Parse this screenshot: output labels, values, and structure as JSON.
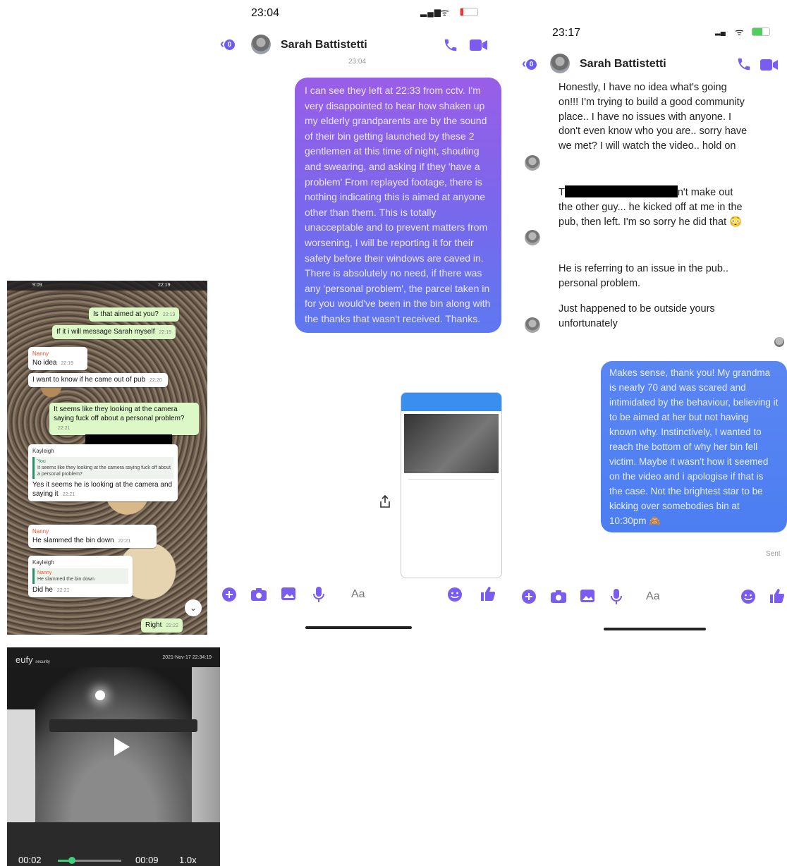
{
  "whatsapp": {
    "status_left": "9:09",
    "status_right": "22:19",
    "messages": [
      {
        "side": "out",
        "text": "Is that aimed at you?",
        "time": "22:19"
      },
      {
        "side": "out",
        "text": "If it i will message Sarah myself",
        "time": "22:19"
      },
      {
        "side": "in",
        "sender": "Nanny",
        "text": "No idea",
        "time": "22:19"
      },
      {
        "side": "in",
        "text": "I want to know if he came out of pub",
        "time": "22:20"
      },
      {
        "side": "out",
        "text": "It seems like they looking at the camera saying fuck off about a personal problem?",
        "time": "22:21"
      },
      {
        "side": "in",
        "sender": "Kayleigh",
        "quote_name": "You",
        "quote_text": "It seems like they looking at the camera saying fuck off about a personal problem?",
        "text": "Yes it seems he is looking at the camera and saying it",
        "time": "22:21"
      },
      {
        "side": "in",
        "sender": "Nanny",
        "text": "He slammed the bin down",
        "time": "22:21"
      },
      {
        "side": "in",
        "sender": "Kayleigh",
        "quote_name": "Nanny",
        "quote_text": "He slammed the bin down",
        "text": "Did he",
        "time": "22:21"
      },
      {
        "side": "out",
        "text": "Right",
        "time": "22:22"
      }
    ]
  },
  "eufy": {
    "brand": "eufy",
    "brand_sub": "security",
    "timestamp": "2021-Nov-17 22:34:19",
    "current_time": "00:02",
    "duration": "00:09",
    "speed": "1.0x",
    "progress": 0.22
  },
  "screen1": {
    "status_time": "23:04",
    "back_badge": "0",
    "contact_name": "Sarah Battistetti",
    "timestamp": "23:04",
    "sent_message": "I can see they left at 22:33 from cctv. I'm very disappointed to hear how shaken up my elderly grandparents are by the sound of their bin getting launched by these 2 gentlemen at this time of night, shouting and swearing, and asking if they 'have a problem' From replayed footage, there is nothing indicating this is aimed at anyone other than them. This is totally unacceptable and to prevent matters from worsening, I will be reporting it for their safety before their windows are caved in. There is absolutely no need, if there was any 'personal problem', the parcel taken in for you would've been in the bin along with the thanks that wasn't received. Thanks.",
    "composer_placeholder": "Aa"
  },
  "screen2": {
    "status_time": "23:17",
    "back_badge": "0",
    "contact_name": "Sarah Battistetti",
    "received": [
      "Honestly, I have no idea what's going on!!! I'm trying to build a good community place.. I have no issues with anyone. I don't even know who you are.. sorry have we met? I will watch the video.. hold on",
      "n't make out the other guy... he kicked off at me in the pub, then left. I'm so sorry he did that 😳",
      "He is referring to an issue in the pub.. personal problem.",
      "Just happened to be outside yours unfortunately"
    ],
    "received_2_prefix": "T",
    "sent_message": "Makes sense, thank you! My grandma is nearly 70 and was scared and intimidated by the behaviour, believing it to be aimed at her but not having known why. Instinctively, I wanted to reach the bottom of why her bin fell victim. Maybe it wasn't how it seemed on the video and i apologise if that is the case. Not the brightest star to be kicking over somebodies bin at 10:30pm 🙈",
    "sent_status": "Sent",
    "composer_placeholder": "Aa"
  },
  "colors": {
    "messenger_accent": "#7b5cf0",
    "whatsapp_out": "#dcf8c6",
    "sent_blue": "#4c7ef2"
  }
}
